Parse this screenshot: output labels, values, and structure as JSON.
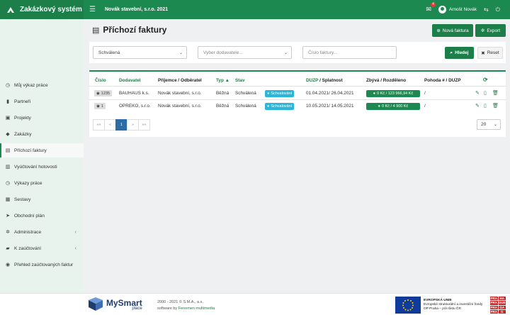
{
  "app": {
    "title": "Zakázkový systém",
    "company": "Novák stavební, s.r.o. 2021",
    "user": "Arnošt Novák",
    "mail_count": "4"
  },
  "sidebar": {
    "items": [
      {
        "label": "Můj výkaz práce",
        "icon": "clock-icon"
      },
      {
        "label": "Partneři",
        "icon": "book-icon"
      },
      {
        "label": "Projekty",
        "icon": "briefcase-icon"
      },
      {
        "label": "Zakázky",
        "icon": "tag-icon"
      },
      {
        "label": "Příchozí faktury",
        "icon": "file-icon",
        "active": true
      },
      {
        "label": "Vyúčtování hotovosti",
        "icon": "receipt-icon"
      },
      {
        "label": "Výkazy práce",
        "icon": "clock-icon"
      },
      {
        "label": "Sestavy",
        "icon": "bar-chart-icon"
      },
      {
        "label": "Obchodní plán",
        "icon": "paper-plane-icon"
      },
      {
        "label": "Administrace",
        "icon": "cogs-icon",
        "chevron": true
      },
      {
        "label": "K zaúčtování",
        "icon": "folder-icon",
        "chevron": true
      },
      {
        "label": "Přehled zaúčtovaných faktur",
        "icon": "check-circle-icon"
      }
    ]
  },
  "page": {
    "title": "Příchozí faktury",
    "new_label": "Nová faktura",
    "export_label": "Export"
  },
  "filters": {
    "status_value": "Schválená",
    "supplier_placeholder": "Vyber dodavatele...",
    "invoice_placeholder": "Číslo faktury...",
    "search_label": "Hledej",
    "reset_label": "Reset"
  },
  "table": {
    "headers": {
      "cislo": "Číslo",
      "dodavatel": "Dodavatel",
      "prijemce": "Příjemce / Odběratel",
      "typ": "Typ",
      "stav": "Stav",
      "duzp": "DUZP",
      "splatnost": "/ Splatnost",
      "zbyva": "Zbývá / Rozděleno",
      "pohoda": "Pohoda # / DUZP"
    },
    "rows": [
      {
        "id": "1235",
        "supplier": "BAUHAUS k.s.",
        "recipient": "Novák stavební, s.r.o.",
        "type": "Běžná",
        "status": "Schválená",
        "status_badge": "Schvalování",
        "dates": "01.04.2021/ 26.04.2021",
        "money": "0 Kč / 123 966,94 Kč",
        "pohoda": "/"
      },
      {
        "id": "1",
        "supplier": "OPREKO, s.r.o.",
        "recipient": "Novák stavební, s.r.o.",
        "type": "Běžná",
        "status": "Schválená",
        "status_badge": "Schvalování",
        "dates": "10.05.2021/ 14.05.2021",
        "money": "0 Kč / 4 900 Kč",
        "pohoda": "/"
      }
    ]
  },
  "pagination": {
    "first": "««",
    "prev": "«",
    "current": "1",
    "next": "»",
    "last": "»»",
    "per_page": "20"
  },
  "footer": {
    "brand_main": "MySmart",
    "brand_sub": "place",
    "copyright": "2000 - 2021 © S.M.A., a.s.",
    "made_by_prefix": "software by ",
    "made_by": "Fenomen multimedia",
    "eu_line1": "EVROPSKÁ UNIE",
    "eu_line2": "Evropské strukturální a investiční fondy",
    "eu_line3": "OP Praha – pól růstu ČR",
    "praha": [
      "PRA",
      "HA",
      "PRA",
      "GUE",
      "PRA",
      "GA",
      "PRA",
      "G"
    ]
  },
  "colors": {
    "primary": "#1c8a50",
    "dark": "#1c7e48",
    "info": "#29b6d8"
  }
}
